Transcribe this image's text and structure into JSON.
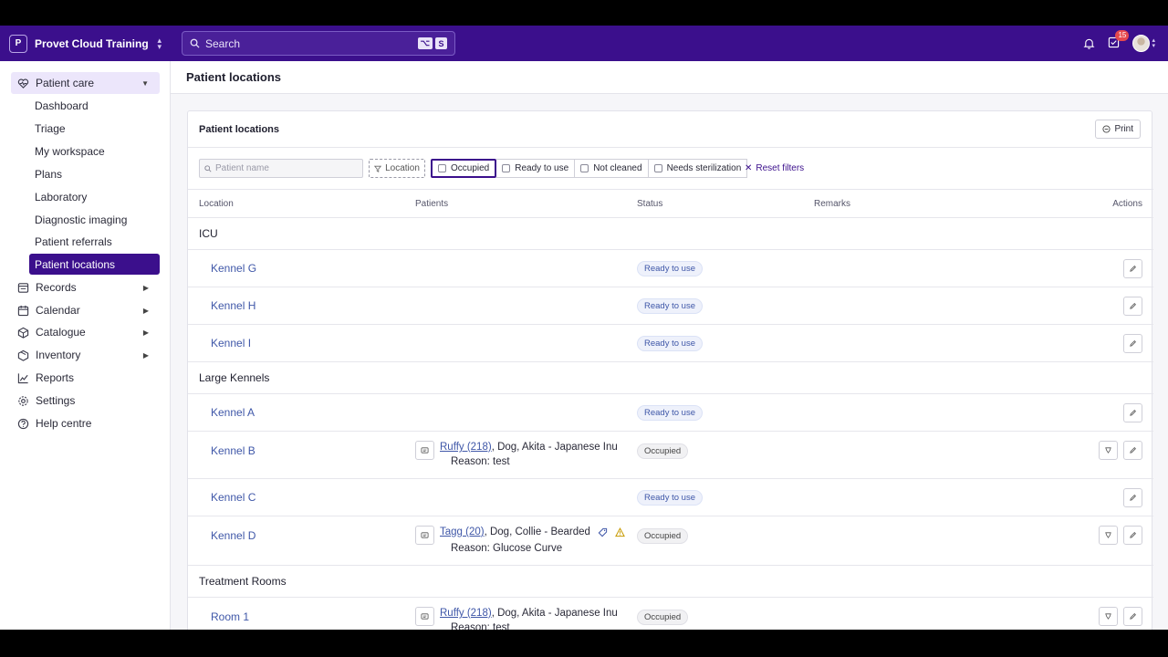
{
  "topbar": {
    "org_initial": "P",
    "org_name": "Provet Cloud Training",
    "search_label": "Search",
    "shortcut_keys": [
      "⌥",
      "S"
    ],
    "tasks_count": "15"
  },
  "sidebar": {
    "patient_care": "Patient care",
    "children": [
      "Dashboard",
      "Triage",
      "My workspace",
      "Plans",
      "Laboratory",
      "Diagnostic imaging",
      "Patient referrals",
      "Patient locations"
    ],
    "sections": [
      "Records",
      "Calendar",
      "Catalogue",
      "Inventory",
      "Reports",
      "Settings",
      "Help centre"
    ]
  },
  "page": {
    "title": "Patient locations",
    "card_title": "Patient locations",
    "print_label": "Print"
  },
  "filters": {
    "patient_placeholder": "Patient name",
    "location_label": "Location",
    "status_options": [
      "Occupied",
      "Ready to use",
      "Not cleaned",
      "Needs sterilization"
    ],
    "reset_label": "Reset filters"
  },
  "table": {
    "headers": [
      "Location",
      "Patients",
      "Status",
      "Remarks",
      "Actions"
    ],
    "groups": [
      "ICU",
      "Large Kennels",
      "Treatment Rooms"
    ],
    "rows": [
      {
        "location": "Kennel G",
        "status": "Ready to use"
      },
      {
        "location": "Kennel H",
        "status": "Ready to use"
      },
      {
        "location": "Kennel I",
        "status": "Ready to use"
      },
      {
        "location": "Kennel A",
        "status": "Ready to use"
      },
      {
        "location": "Kennel B",
        "status": "Occupied",
        "patient_link": "Ruffy (218)",
        "patient_desc": ", Dog, Akita - Japanese Inu",
        "reason": "Reason: test"
      },
      {
        "location": "Kennel C",
        "status": "Ready to use"
      },
      {
        "location": "Kennel D",
        "status": "Occupied",
        "patient_link": "Tagg (20)",
        "patient_desc": ", Dog, Collie - Bearded",
        "reason": "Reason: Glucose Curve"
      },
      {
        "location": "Room 1",
        "status": "Occupied",
        "patient_link": "Ruffy (218)",
        "patient_desc": ", Dog, Akita - Japanese Inu",
        "reason": "Reason: test"
      }
    ]
  },
  "colors": {
    "brand": "#3b0f8c",
    "link": "#3f57a8"
  }
}
